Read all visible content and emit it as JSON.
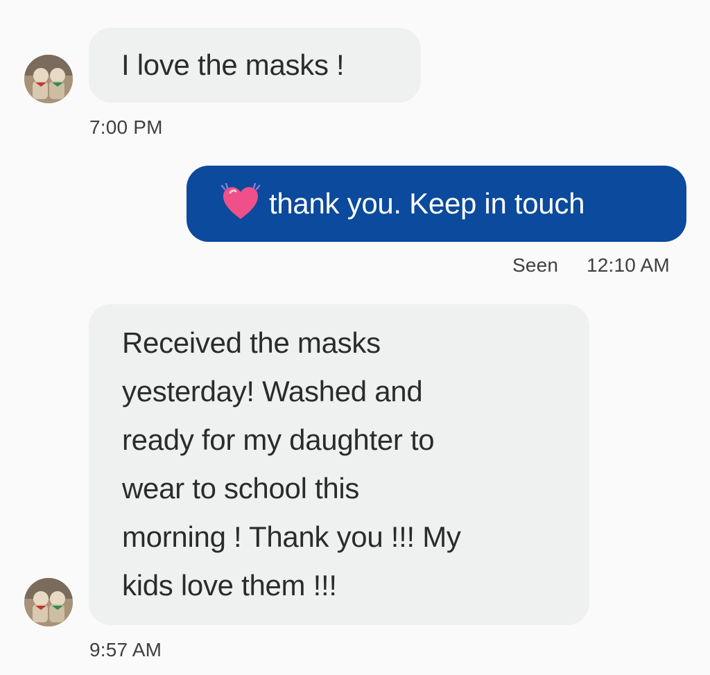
{
  "thread": {
    "messages": [
      {
        "direction": "incoming",
        "text": "I love the masks !",
        "time": "7:00 PM"
      },
      {
        "direction": "outgoing",
        "emoji": "beating-heart",
        "text": "thank you. Keep in touch",
        "status": "Seen",
        "time": "12:10 AM"
      },
      {
        "direction": "incoming",
        "lines": [
          "Received the masks",
          "yesterday! Washed and",
          "ready for my daughter to",
          "wear to school this",
          "morning ! Thank you !!! My",
          "kids love them !!!"
        ],
        "time": "9:57 AM"
      }
    ]
  },
  "colors": {
    "incoming_bubble": "#eff0f0",
    "outgoing_bubble": "#0b4a9c",
    "background": "#fafafa",
    "heart": "#f0508a"
  }
}
